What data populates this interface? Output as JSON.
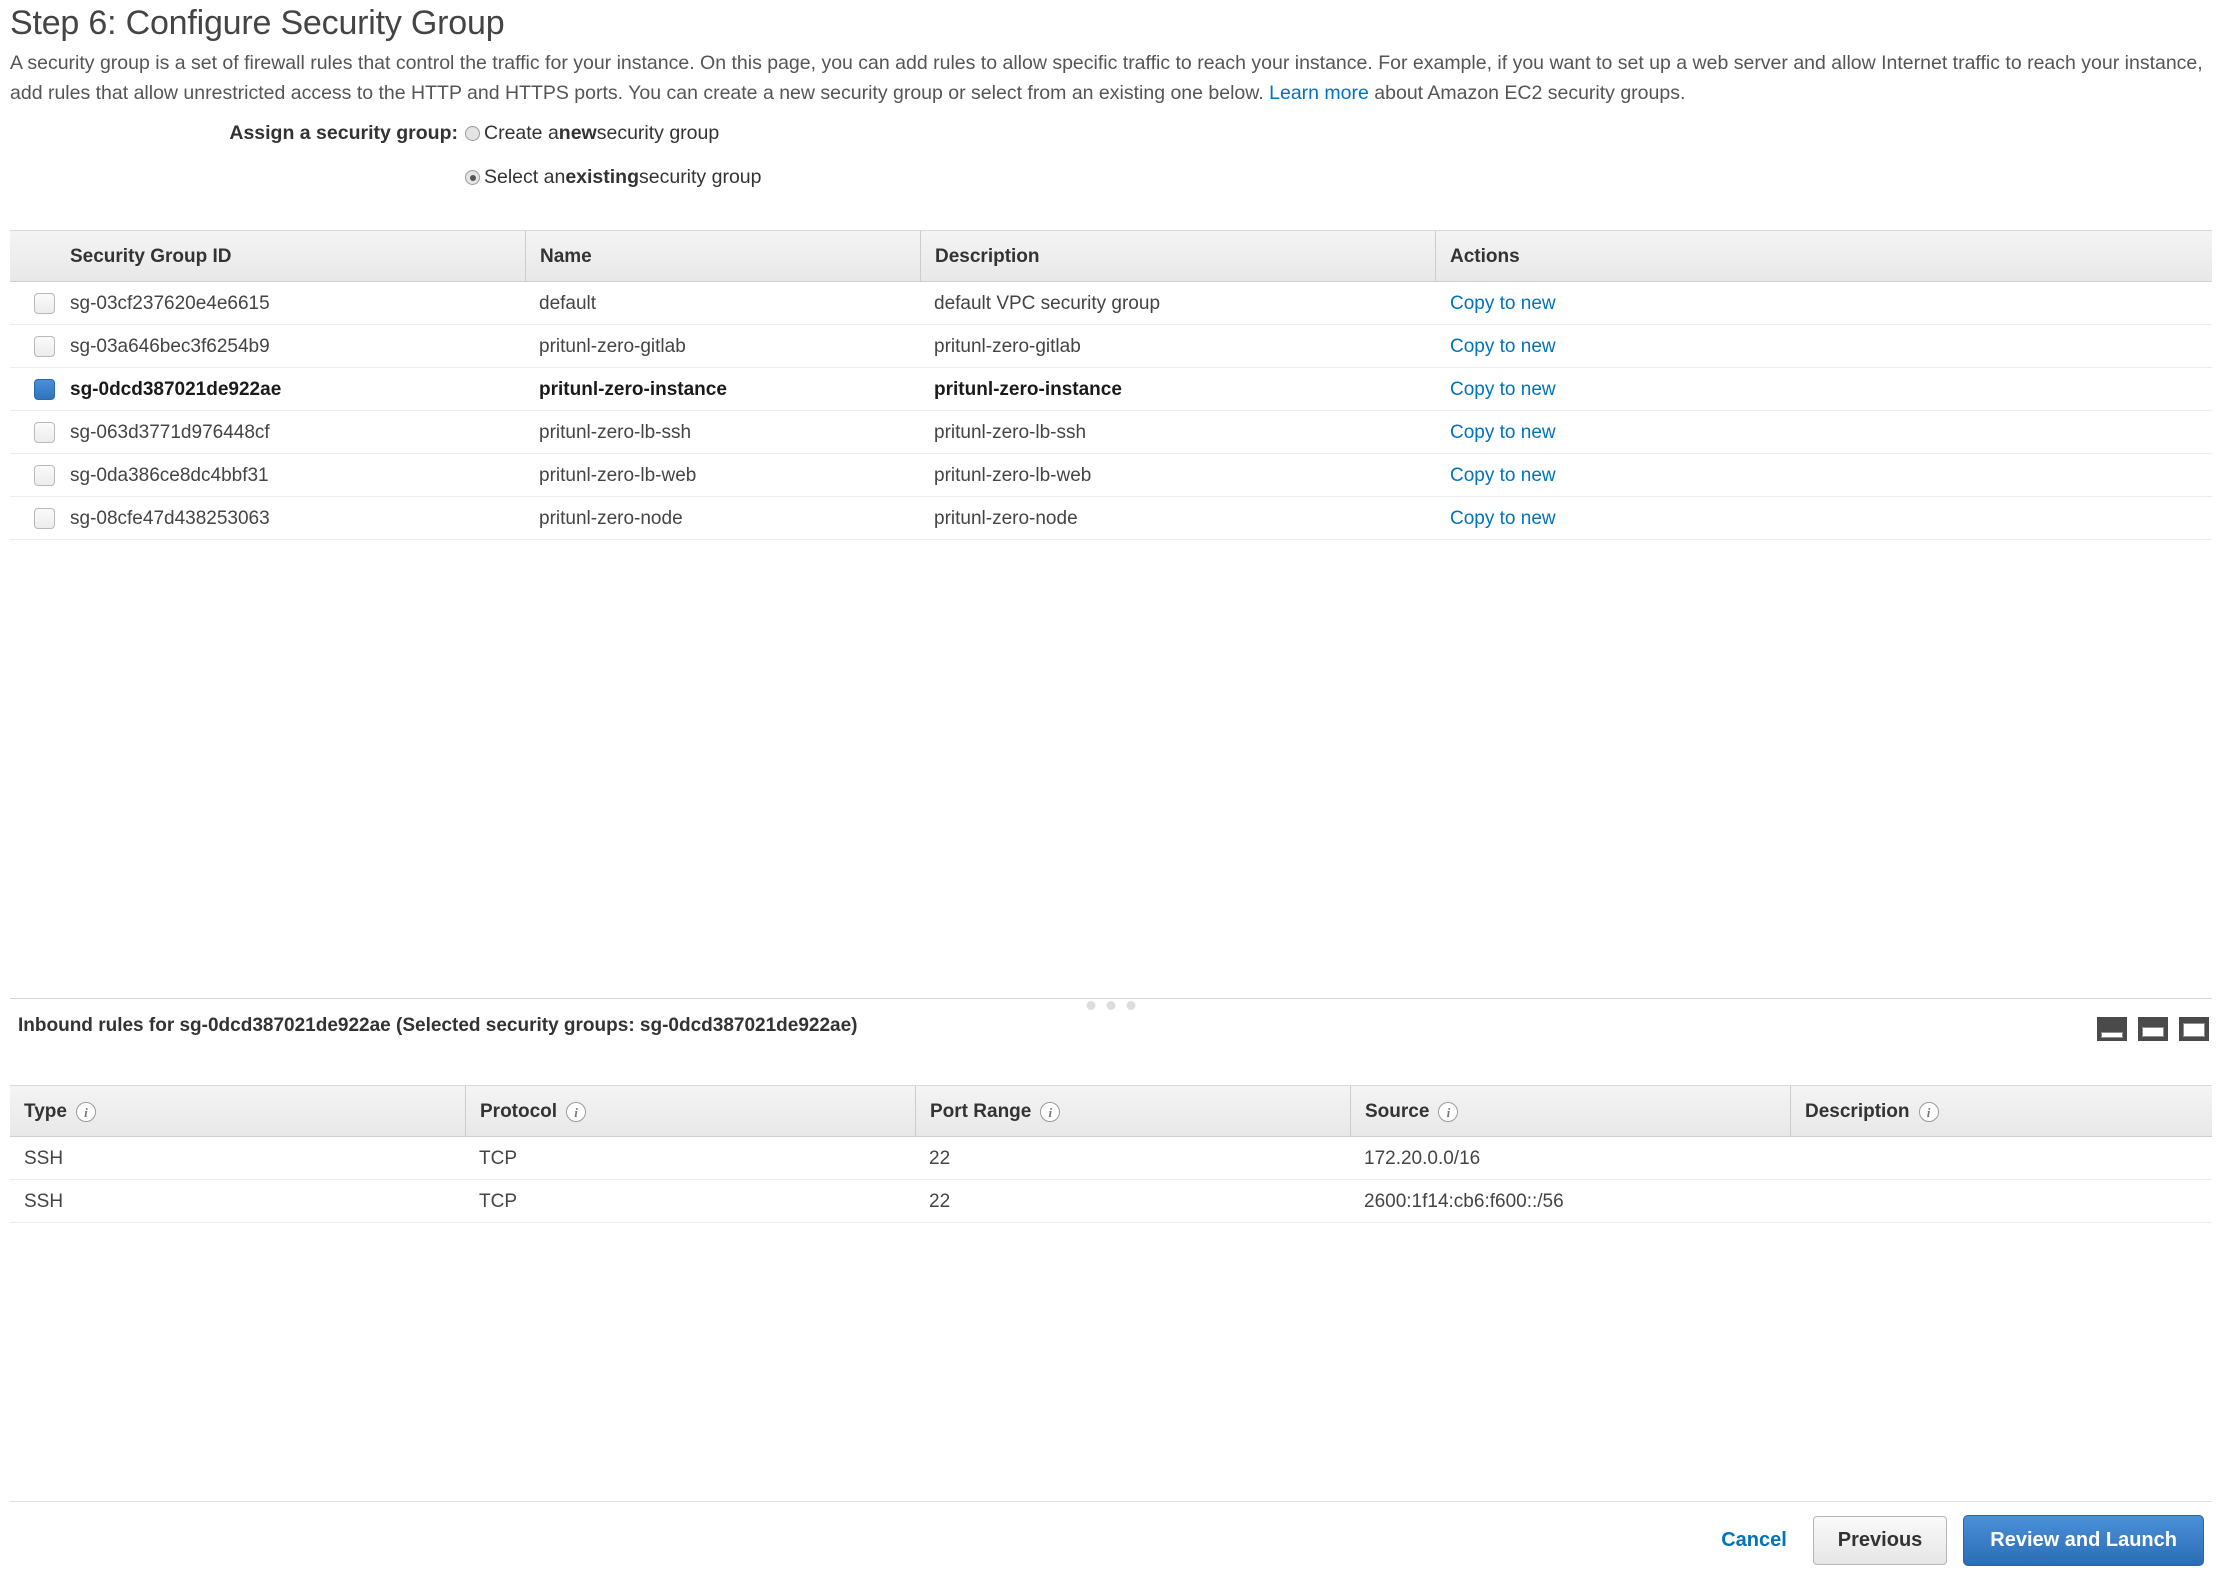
{
  "header": {
    "step_title": "Step 6: Configure Security Group",
    "description_part1": "A security group is a set of firewall rules that control the traffic for your instance. On this page, you can add rules to allow specific traffic to reach your instance. For example, if you want to set up a web server and allow Internet traffic to reach your instance, add rules that allow unrestricted access to the HTTP and HTTPS ports. You can create a new security group or select from an existing one below.",
    "learn_more_label": "Learn more",
    "description_part2": "about Amazon EC2 security groups."
  },
  "assign": {
    "label": "Assign a security group:",
    "option_new_pre": "Create a ",
    "option_new_bold": "new",
    "option_new_post": " security group",
    "option_existing_pre": "Select an ",
    "option_existing_bold": "existing",
    "option_existing_post": " security group",
    "selected": "existing"
  },
  "groups_table": {
    "columns": [
      "Security Group ID",
      "Name",
      "Description",
      "Actions"
    ],
    "action_label": "Copy to new",
    "rows": [
      {
        "id": "sg-03cf237620e4e6615",
        "name": "default",
        "description": "default VPC security group",
        "checked": false
      },
      {
        "id": "sg-03a646bec3f6254b9",
        "name": "pritunl-zero-gitlab",
        "description": "pritunl-zero-gitlab",
        "checked": false
      },
      {
        "id": "sg-0dcd387021de922ae",
        "name": "pritunl-zero-instance",
        "description": "pritunl-zero-instance",
        "checked": true
      },
      {
        "id": "sg-063d3771d976448cf",
        "name": "pritunl-zero-lb-ssh",
        "description": "pritunl-zero-lb-ssh",
        "checked": false
      },
      {
        "id": "sg-0da386ce8dc4bbf31",
        "name": "pritunl-zero-lb-web",
        "description": "pritunl-zero-lb-web",
        "checked": false
      },
      {
        "id": "sg-08cfe47d438253063",
        "name": "pritunl-zero-node",
        "description": "pritunl-zero-node",
        "checked": false
      }
    ]
  },
  "inbound": {
    "caption": "Inbound rules for sg-0dcd387021de922ae (Selected security groups: sg-0dcd387021de922ae)",
    "columns": [
      "Type",
      "Protocol",
      "Port Range",
      "Source",
      "Description"
    ],
    "rows": [
      {
        "type": "SSH",
        "protocol": "TCP",
        "port_range": "22",
        "source": "172.20.0.0/16",
        "description": ""
      },
      {
        "type": "SSH",
        "protocol": "TCP",
        "port_range": "22",
        "source": "2600:1f14:cb6:f600::/56",
        "description": ""
      }
    ],
    "layout_buttons": [
      "split-bottom-small-icon",
      "split-bottom-medium-icon",
      "split-bottom-large-icon"
    ]
  },
  "footer": {
    "cancel_label": "Cancel",
    "previous_label": "Previous",
    "primary_label": "Review and Launch"
  },
  "colors": {
    "link": "#0073bb",
    "primary_button": "#2a6db5",
    "checkbox_checked": "#3b7fc4"
  }
}
